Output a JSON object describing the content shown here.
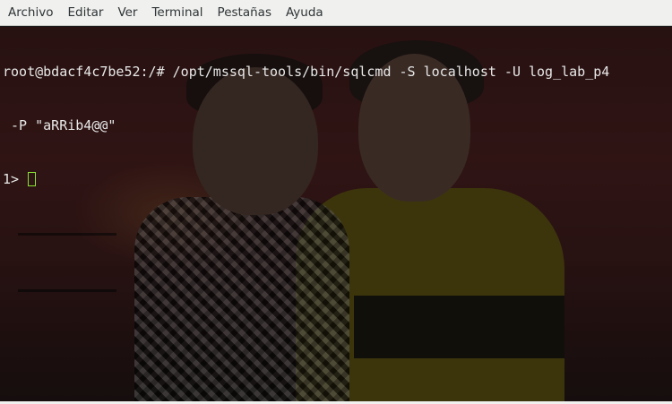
{
  "menubar": {
    "items": [
      {
        "label": "Archivo"
      },
      {
        "label": "Editar"
      },
      {
        "label": "Ver"
      },
      {
        "label": "Terminal"
      },
      {
        "label": "Pestañas"
      },
      {
        "label": "Ayuda"
      }
    ]
  },
  "terminal": {
    "lines": [
      "root@bdacf4c7be52:/# /opt/mssql-tools/bin/sqlcmd -S localhost -U log_lab_p4",
      " -P \"aRRib4@@\"",
      "1> "
    ],
    "cursor_color": "#8ae234"
  }
}
